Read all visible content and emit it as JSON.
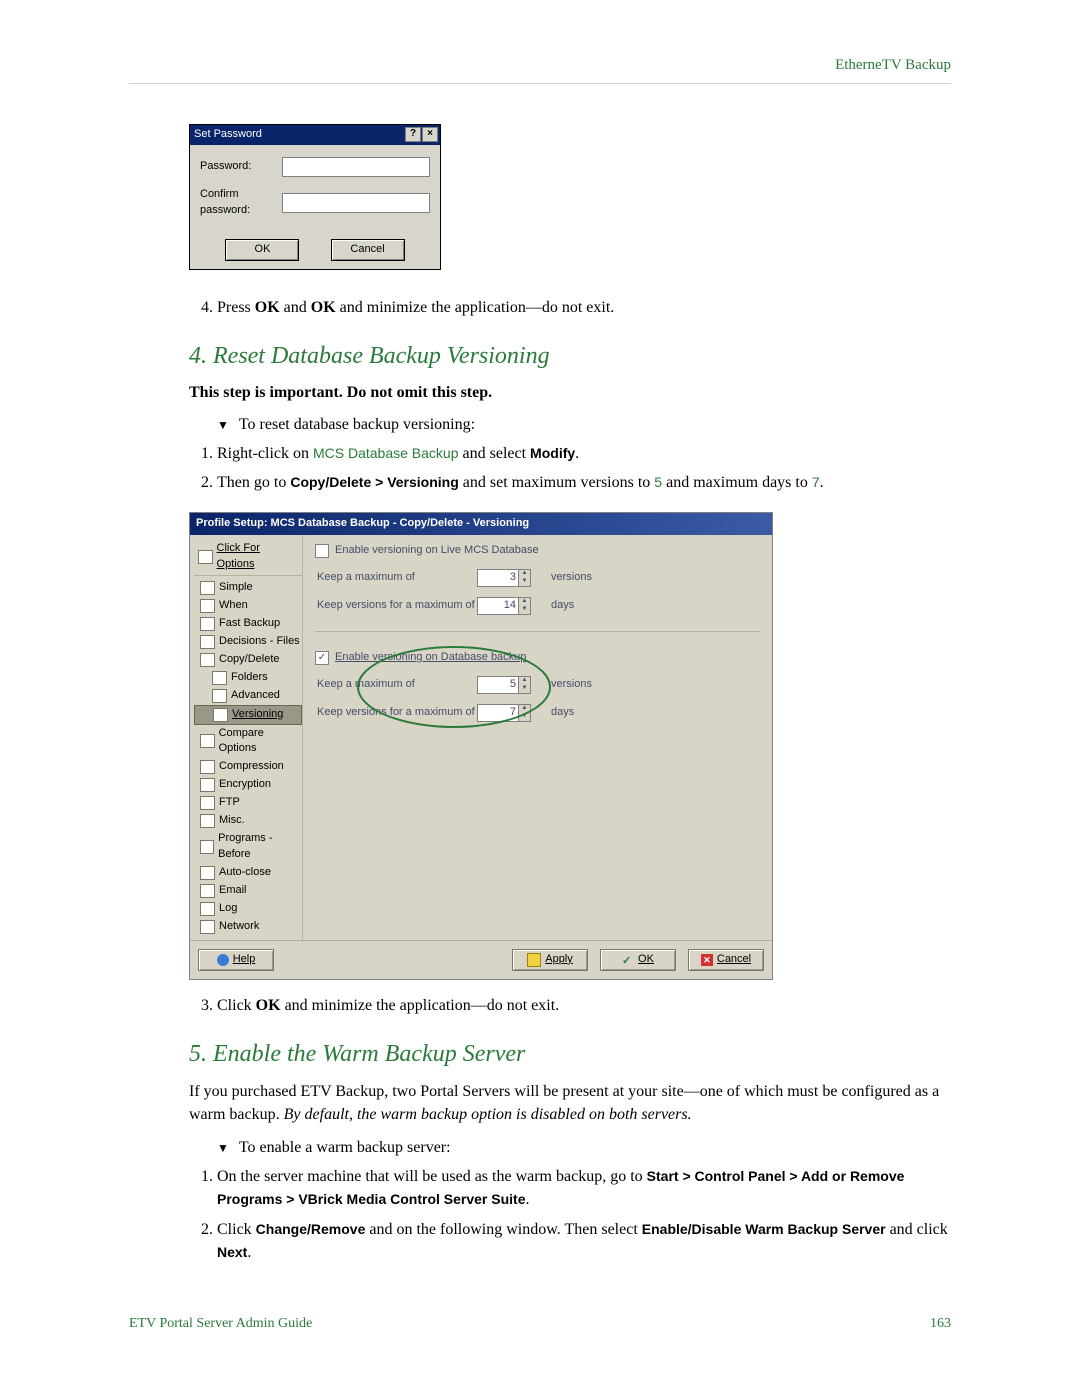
{
  "header": {
    "section": "EtherneTV Backup"
  },
  "dialog1": {
    "title": "Set Password",
    "labels": {
      "password": "Password:",
      "confirm": "Confirm password:"
    },
    "buttons": {
      "ok": "OK",
      "cancel": "Cancel"
    }
  },
  "step4_list": {
    "item4_a": "Press ",
    "item4_b": " and ",
    "item4_c": " and minimize the application—do not exit.",
    "ok": "OK"
  },
  "sec4": {
    "title": "4. Reset Database Backup Versioning",
    "subhead": "This step is important. Do not omit this step.",
    "intro": "To reset database backup versioning:",
    "li1_a": "Right-click on ",
    "li1_b": "MCS Database Backup",
    "li1_c": " and select ",
    "li1_d": "Modify",
    "li1_e": ".",
    "li2_a": "Then go to ",
    "li2_b": "Copy/Delete > Versioning",
    "li2_c": " and set maximum versions to ",
    "li2_d": "5",
    "li2_e": " and maximum days to ",
    "li2_f": "7",
    "li2_g": "."
  },
  "profile": {
    "title": "Profile Setup: MCS Database Backup - Copy/Delete - Versioning",
    "click": "Click For Options",
    "sidebar": [
      {
        "label": "Simple",
        "sub": false
      },
      {
        "label": "When",
        "sub": false
      },
      {
        "label": "Fast Backup",
        "sub": false
      },
      {
        "label": "Decisions - Files",
        "sub": false
      },
      {
        "label": "Copy/Delete",
        "sub": false
      },
      {
        "label": "Folders",
        "sub": true
      },
      {
        "label": "Advanced",
        "sub": true
      },
      {
        "label": "Versioning",
        "sub": true,
        "sel": true,
        "ul": true
      },
      {
        "label": "Compare Options",
        "sub": false
      },
      {
        "label": "Compression",
        "sub": false
      },
      {
        "label": "Encryption",
        "sub": false
      },
      {
        "label": "FTP",
        "sub": false
      },
      {
        "label": "Misc.",
        "sub": false
      },
      {
        "label": "Programs - Before",
        "sub": false
      },
      {
        "label": "Auto-close",
        "sub": false
      },
      {
        "label": "Email",
        "sub": false
      },
      {
        "label": "Log",
        "sub": false
      },
      {
        "label": "Network",
        "sub": false
      }
    ],
    "top": {
      "chk_label": "Enable versioning on Live MCS Database",
      "max_versions_label": "Keep a maximum of",
      "max_versions_val": "3",
      "versions_word": "versions",
      "max_days_label": "Keep versions for a maximum of",
      "max_days_val": "14",
      "days_word": "days"
    },
    "bottom": {
      "chk_label": "Enable versioning on Database backup",
      "max_versions_label": "Keep a maximum of",
      "max_versions_val": "5",
      "versions_word": "versions",
      "max_days_label": "Keep versions for a maximum of",
      "max_days_val": "7",
      "days_word": "days"
    },
    "buttons": {
      "help": "Help",
      "apply": "Apply",
      "ok": "OK",
      "cancel": "Cancel"
    }
  },
  "sec4_post": {
    "li3_a": "Click ",
    "li3_b": "OK",
    "li3_c": " and minimize the application—do not exit."
  },
  "sec5": {
    "title": "5. Enable the Warm Backup Server",
    "p1_a": "If you purchased ETV Backup, two Portal Servers will be present at your site—one of which must be configured as a warm backup. ",
    "p1_b": "By default, the warm backup option is disabled on both servers.",
    "intro": "To enable a warm backup server:",
    "li1_a": "On the server machine that will be used as the warm backup, go to ",
    "li1_b": "Start > Control Panel > Add or Remove Programs > VBrick Media Control Server Suite",
    "li1_c": ".",
    "li2_a": "Click ",
    "li2_b": "Change/Remove",
    "li2_c": " and on the following window. Then select ",
    "li2_d": "Enable/Disable Warm Backup Server",
    "li2_e": " and click ",
    "li2_f": "Next",
    "li2_g": "."
  },
  "footer": {
    "guide": "ETV Portal Server Admin Guide",
    "page": "163"
  }
}
